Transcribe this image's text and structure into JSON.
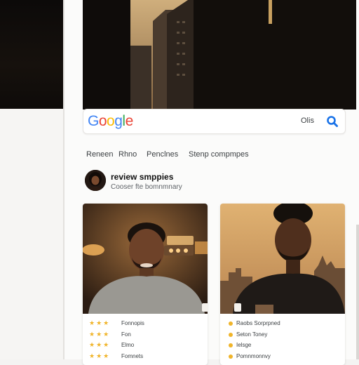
{
  "search": {
    "logo": [
      "G",
      "o",
      "o",
      "g",
      "l",
      "e"
    ],
    "value": "Olis",
    "icon": "search-icon"
  },
  "tabs": [
    "Reneen",
    "Rhno",
    "Penclnes",
    "Stenp compmpes"
  ],
  "profile": {
    "title": "review smppies",
    "subtitle": "Cooser fte bomnmnary"
  },
  "cards": [
    {
      "rows": [
        {
          "stars": "★★★",
          "text": "Fonnopis"
        },
        {
          "stars": "★★★",
          "text": "Fon"
        },
        {
          "stars": "★★★",
          "text": "Elmo"
        },
        {
          "stars": "★★★",
          "text": "Fomnets"
        }
      ]
    },
    {
      "rows": [
        {
          "text": "Raobs Sorprpned"
        },
        {
          "text": "Seton Toney"
        },
        {
          "text": "Ielsge"
        },
        {
          "text": "Pomnmonnvy"
        }
      ]
    }
  ],
  "colors": {
    "accent_blue": "#4285f4",
    "star": "#f0b429"
  }
}
